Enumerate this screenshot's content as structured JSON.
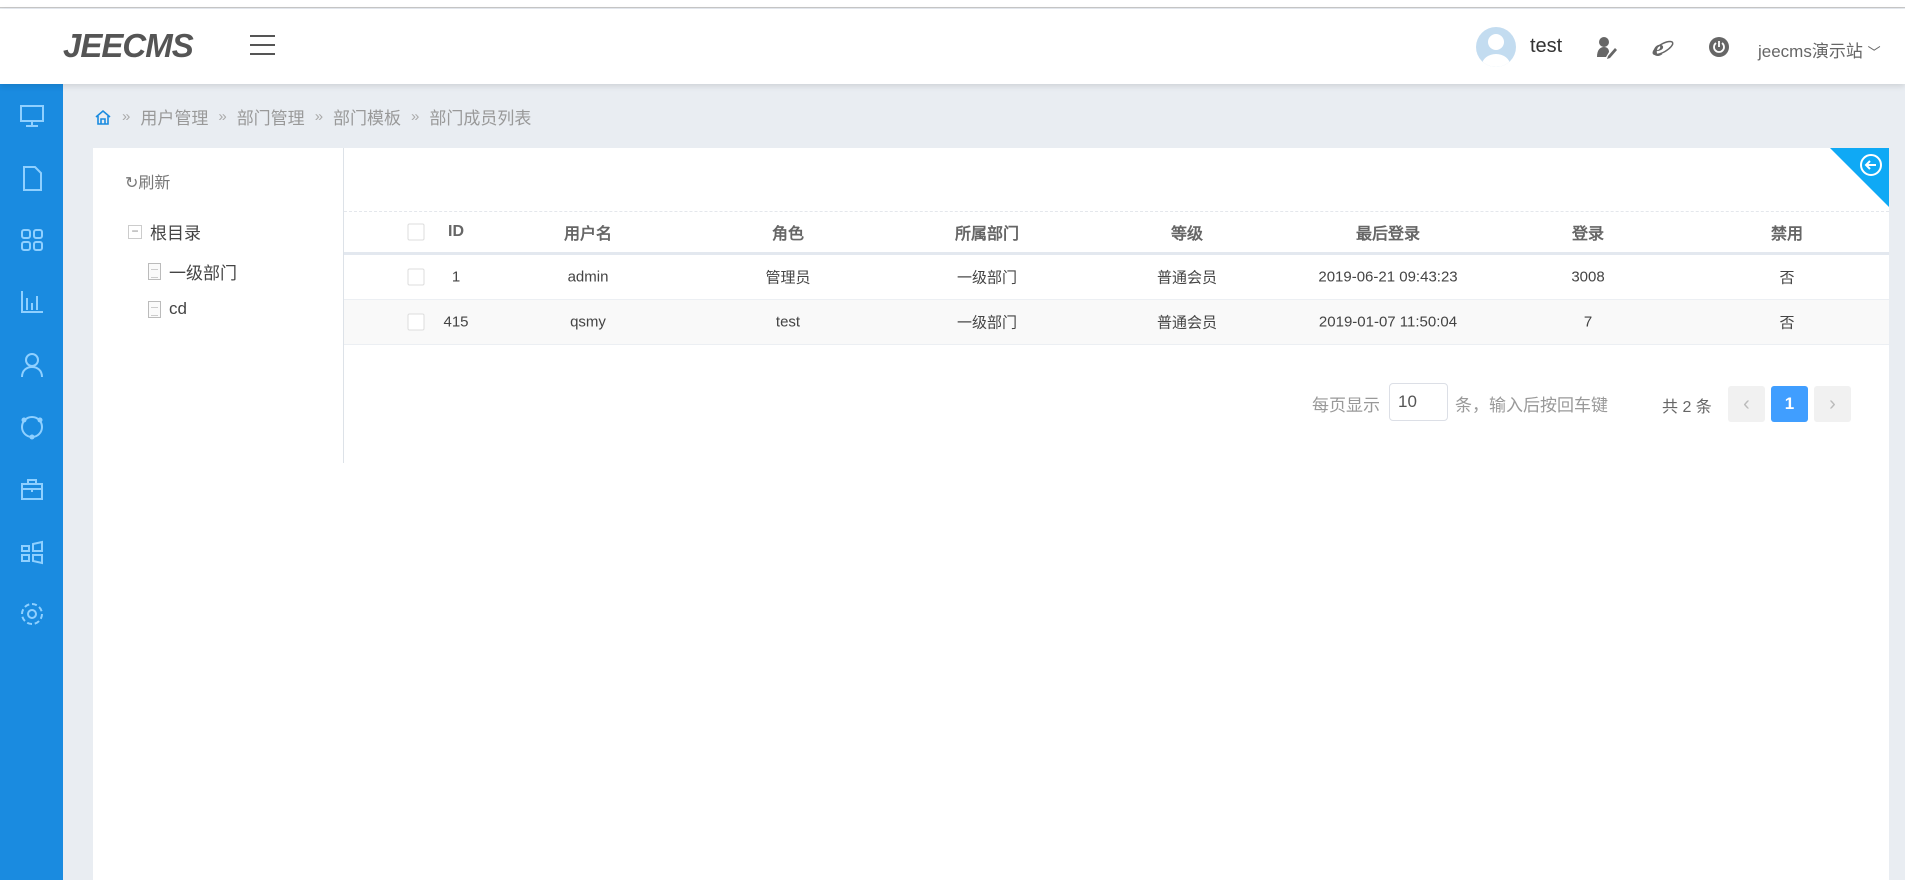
{
  "header": {
    "logo": "JEECMS",
    "user": "test",
    "site": "jeecms演示站"
  },
  "breadcrumb": [
    "用户管理",
    "部门管理",
    "部门模板",
    "部门成员列表"
  ],
  "tree": {
    "refresh": "刷新",
    "root": "根目录",
    "children": [
      "一级部门",
      "cd"
    ]
  },
  "table": {
    "columns": [
      "ID",
      "用户名",
      "角色",
      "所属部门",
      "等级",
      "最后登录",
      "登录",
      "禁用"
    ],
    "rows": [
      [
        "1",
        "admin",
        "管理员",
        "一级部门",
        "普通会员",
        "2019-06-21 09:43:23",
        "3008",
        "否"
      ],
      [
        "415",
        "qsmy",
        "test",
        "一级部门",
        "普通会员",
        "2019-01-07 11:50:04",
        "7",
        "否"
      ]
    ]
  },
  "pagination": {
    "per_page_label": "每页显示",
    "per_page_value": "10",
    "hint": "条，输入后按回车键",
    "total": "共 2 条",
    "current_page": "1",
    "prev": "‹",
    "next": "›"
  },
  "colors": {
    "sidebar": "#1a8be0",
    "accent": "#409eff",
    "corner": "#0fa9f5"
  }
}
